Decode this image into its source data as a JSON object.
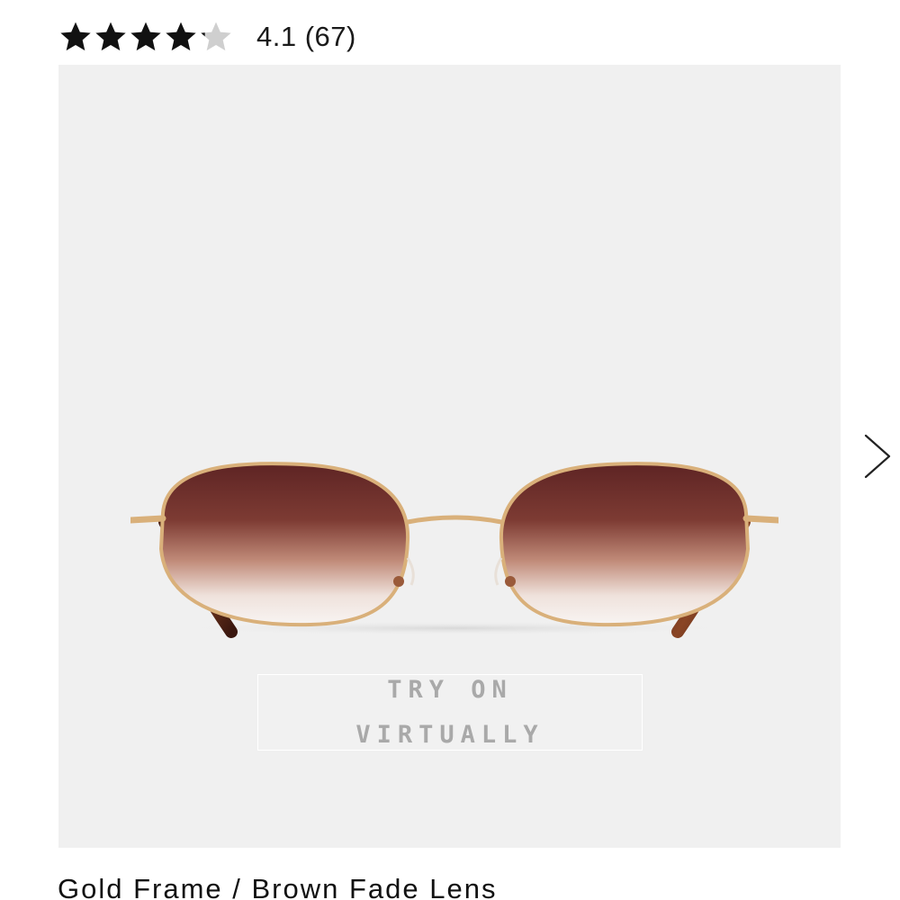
{
  "rating": {
    "value": 4.1,
    "max": 5,
    "text": "4.1 (67)"
  },
  "product_image": {
    "alt": "Gold frame sunglasses with brown fade lenses",
    "colors": {
      "background": "#f0f0f0",
      "frame": "#d9b07a",
      "lens_top": "#5e2424",
      "lens_bottom": "#f6eeea",
      "temple": "#7a3a22"
    }
  },
  "try_on": {
    "line1": "TRY ON",
    "line2": "VIRTUALLY"
  },
  "carousel": {
    "next_icon": "chevron-right-icon"
  },
  "variant": {
    "name": "Gold Frame / Brown Fade Lens"
  },
  "colors": {
    "star_filled": "#111111",
    "star_empty": "#cfcfcf"
  }
}
